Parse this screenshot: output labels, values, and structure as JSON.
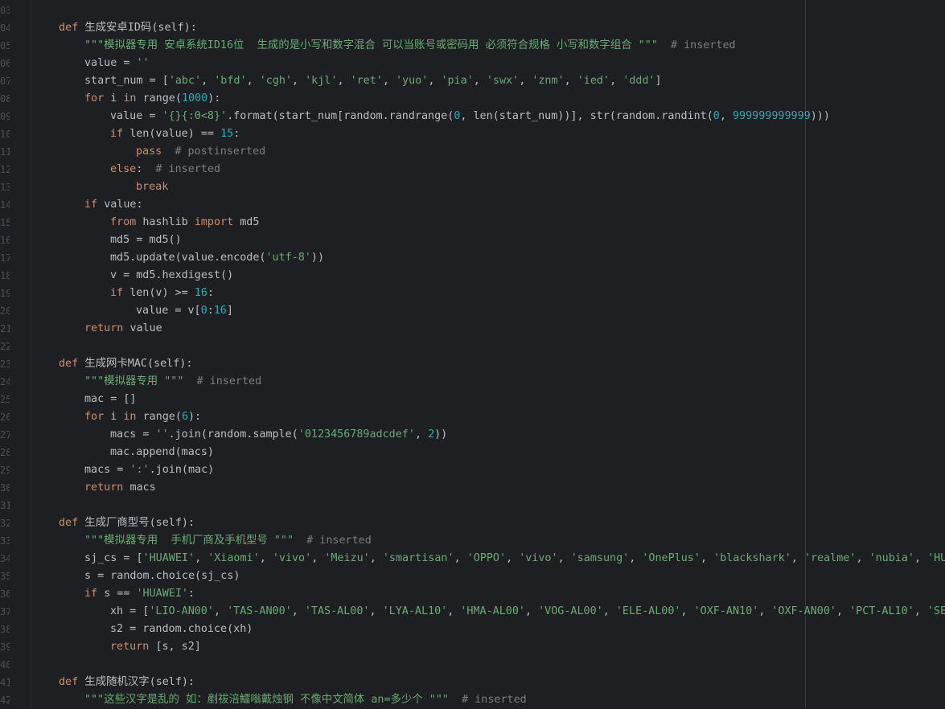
{
  "lines": [
    {
      "n": "03",
      "indent": 0,
      "tokens": []
    },
    {
      "n": "04",
      "indent": 0,
      "tokens": [
        [
          "kw",
          "def "
        ],
        [
          "fn",
          "生成安卓ID码(self):"
        ]
      ]
    },
    {
      "n": "05",
      "indent": 1,
      "tokens": [
        [
          "str",
          "\"\"\"模拟器专用 安卓系统ID16位  生成的是小写和数字混合 可以当账号或密码用 必须符合规格 小写和数字组合 \"\"\""
        ],
        [
          "com",
          "  # inserted"
        ]
      ]
    },
    {
      "n": "06",
      "indent": 1,
      "tokens": [
        [
          "fn",
          "value = "
        ],
        [
          "str",
          "''"
        ]
      ]
    },
    {
      "n": "07",
      "indent": 1,
      "tokens": [
        [
          "fn",
          "start_num = ["
        ],
        [
          "str",
          "'abc'"
        ],
        [
          "fn",
          ", "
        ],
        [
          "str",
          "'bfd'"
        ],
        [
          "fn",
          ", "
        ],
        [
          "str",
          "'cgh'"
        ],
        [
          "fn",
          ", "
        ],
        [
          "str",
          "'kjl'"
        ],
        [
          "fn",
          ", "
        ],
        [
          "str",
          "'ret'"
        ],
        [
          "fn",
          ", "
        ],
        [
          "str",
          "'yuo'"
        ],
        [
          "fn",
          ", "
        ],
        [
          "str",
          "'pia'"
        ],
        [
          "fn",
          ", "
        ],
        [
          "str",
          "'swx'"
        ],
        [
          "fn",
          ", "
        ],
        [
          "str",
          "'znm'"
        ],
        [
          "fn",
          ", "
        ],
        [
          "str",
          "'ied'"
        ],
        [
          "fn",
          ", "
        ],
        [
          "str",
          "'ddd'"
        ],
        [
          "fn",
          "]"
        ]
      ]
    },
    {
      "n": "08",
      "indent": 1,
      "tokens": [
        [
          "kw",
          "for "
        ],
        [
          "fn",
          "i "
        ],
        [
          "kw",
          "in "
        ],
        [
          "fn",
          "range("
        ],
        [
          "num",
          "1000"
        ],
        [
          "fn",
          "):"
        ]
      ]
    },
    {
      "n": "09",
      "indent": 2,
      "tokens": [
        [
          "fn",
          "value = "
        ],
        [
          "str",
          "'{}{:0<8}'"
        ],
        [
          "fn",
          ".format(start_num[random.randrange("
        ],
        [
          "num",
          "0"
        ],
        [
          "fn",
          ", len(start_num))], str(random.randint("
        ],
        [
          "num",
          "0"
        ],
        [
          "fn",
          ", "
        ],
        [
          "num",
          "999999999999"
        ],
        [
          "fn",
          ")))"
        ]
      ]
    },
    {
      "n": "10",
      "indent": 2,
      "tokens": [
        [
          "kw",
          "if "
        ],
        [
          "fn",
          "len(value) == "
        ],
        [
          "num",
          "15"
        ],
        [
          "fn",
          ":"
        ]
      ]
    },
    {
      "n": "11",
      "indent": 3,
      "tokens": [
        [
          "kw",
          "pass"
        ],
        [
          "com",
          "  # postinserted"
        ]
      ]
    },
    {
      "n": "12",
      "indent": 2,
      "tokens": [
        [
          "kw",
          "else"
        ],
        [
          "fn",
          ":"
        ],
        [
          "com",
          "  # inserted"
        ]
      ]
    },
    {
      "n": "13",
      "indent": 3,
      "tokens": [
        [
          "kw",
          "break"
        ]
      ]
    },
    {
      "n": "14",
      "indent": 1,
      "tokens": [
        [
          "kw",
          "if "
        ],
        [
          "fn",
          "value:"
        ]
      ]
    },
    {
      "n": "15",
      "indent": 2,
      "tokens": [
        [
          "kw",
          "from "
        ],
        [
          "fn",
          "hashlib "
        ],
        [
          "kw",
          "import "
        ],
        [
          "fn",
          "md5"
        ]
      ]
    },
    {
      "n": "16",
      "indent": 2,
      "tokens": [
        [
          "fn",
          "md5 = md5()"
        ]
      ]
    },
    {
      "n": "17",
      "indent": 2,
      "tokens": [
        [
          "fn",
          "md5.update(value.encode("
        ],
        [
          "str",
          "'utf-8'"
        ],
        [
          "fn",
          "))"
        ]
      ]
    },
    {
      "n": "18",
      "indent": 2,
      "tokens": [
        [
          "fn",
          "v = md5.hexdigest()"
        ]
      ]
    },
    {
      "n": "19",
      "indent": 2,
      "tokens": [
        [
          "kw",
          "if "
        ],
        [
          "fn",
          "len(v) >= "
        ],
        [
          "num",
          "16"
        ],
        [
          "fn",
          ":"
        ]
      ]
    },
    {
      "n": "20",
      "indent": 3,
      "tokens": [
        [
          "fn",
          "value = v["
        ],
        [
          "num",
          "0"
        ],
        [
          "fn",
          ":"
        ],
        [
          "num",
          "16"
        ],
        [
          "fn",
          "]"
        ]
      ]
    },
    {
      "n": "21",
      "indent": 1,
      "tokens": [
        [
          "kw",
          "return "
        ],
        [
          "fn",
          "value"
        ]
      ]
    },
    {
      "n": "22",
      "indent": 0,
      "tokens": []
    },
    {
      "n": "23",
      "indent": 0,
      "tokens": [
        [
          "kw",
          "def "
        ],
        [
          "fn",
          "生成网卡MAC(self):"
        ]
      ]
    },
    {
      "n": "24",
      "indent": 1,
      "tokens": [
        [
          "str",
          "\"\"\"模拟器专用 \"\"\""
        ],
        [
          "com",
          "  # inserted"
        ]
      ]
    },
    {
      "n": "25",
      "indent": 1,
      "tokens": [
        [
          "fn",
          "mac = []"
        ]
      ]
    },
    {
      "n": "26",
      "indent": 1,
      "tokens": [
        [
          "kw",
          "for "
        ],
        [
          "fn",
          "i "
        ],
        [
          "kw",
          "in "
        ],
        [
          "fn",
          "range("
        ],
        [
          "num",
          "6"
        ],
        [
          "fn",
          "):"
        ]
      ]
    },
    {
      "n": "27",
      "indent": 2,
      "tokens": [
        [
          "fn",
          "macs = "
        ],
        [
          "str",
          "''"
        ],
        [
          "fn",
          ".join(random.sample("
        ],
        [
          "str",
          "'0123456789adcdef'"
        ],
        [
          "fn",
          ", "
        ],
        [
          "num",
          "2"
        ],
        [
          "fn",
          "))"
        ]
      ]
    },
    {
      "n": "28",
      "indent": 2,
      "tokens": [
        [
          "fn",
          "mac.append(macs)"
        ]
      ]
    },
    {
      "n": "29",
      "indent": 1,
      "tokens": [
        [
          "fn",
          "macs = "
        ],
        [
          "str",
          "':'"
        ],
        [
          "fn",
          ".join(mac)"
        ]
      ]
    },
    {
      "n": "30",
      "indent": 1,
      "tokens": [
        [
          "kw",
          "return "
        ],
        [
          "fn",
          "macs"
        ]
      ]
    },
    {
      "n": "31",
      "indent": 0,
      "tokens": []
    },
    {
      "n": "32",
      "indent": 0,
      "tokens": [
        [
          "kw",
          "def "
        ],
        [
          "fn",
          "生成厂商型号(self):"
        ]
      ]
    },
    {
      "n": "33",
      "indent": 1,
      "tokens": [
        [
          "str",
          "\"\"\"模拟器专用  手机厂商及手机型号 \"\"\""
        ],
        [
          "com",
          "  # inserted"
        ]
      ]
    },
    {
      "n": "34",
      "indent": 1,
      "tokens": [
        [
          "fn",
          "sj_cs = ["
        ],
        [
          "str",
          "'HUAWEI'"
        ],
        [
          "fn",
          ", "
        ],
        [
          "str",
          "'Xiaomi'"
        ],
        [
          "fn",
          ", "
        ],
        [
          "str",
          "'vivo'"
        ],
        [
          "fn",
          ", "
        ],
        [
          "str",
          "'Meizu'"
        ],
        [
          "fn",
          ", "
        ],
        [
          "str",
          "'smartisan'"
        ],
        [
          "fn",
          ", "
        ],
        [
          "str",
          "'OPPO'"
        ],
        [
          "fn",
          ", "
        ],
        [
          "str",
          "'vivo'"
        ],
        [
          "fn",
          ", "
        ],
        [
          "str",
          "'samsung'"
        ],
        [
          "fn",
          ", "
        ],
        [
          "str",
          "'OnePlus'"
        ],
        [
          "fn",
          ", "
        ],
        [
          "str",
          "'blackshark'"
        ],
        [
          "fn",
          ", "
        ],
        [
          "str",
          "'realme'"
        ],
        [
          "fn",
          ", "
        ],
        [
          "str",
          "'nubia'"
        ],
        [
          "fn",
          ", "
        ],
        [
          "str",
          "'HUA"
        ]
      ]
    },
    {
      "n": "35",
      "indent": 1,
      "tokens": [
        [
          "fn",
          "s = random.choice(sj_cs)"
        ]
      ]
    },
    {
      "n": "36",
      "indent": 1,
      "tokens": [
        [
          "kw",
          "if "
        ],
        [
          "fn",
          "s == "
        ],
        [
          "str",
          "'HUAWEI'"
        ],
        [
          "fn",
          ":"
        ]
      ]
    },
    {
      "n": "37",
      "indent": 2,
      "tokens": [
        [
          "fn",
          "xh = ["
        ],
        [
          "str",
          "'LIO-AN00'"
        ],
        [
          "fn",
          ", "
        ],
        [
          "str",
          "'TAS-AN00'"
        ],
        [
          "fn",
          ", "
        ],
        [
          "str",
          "'TAS-AL00'"
        ],
        [
          "fn",
          ", "
        ],
        [
          "str",
          "'LYA-AL10'"
        ],
        [
          "fn",
          ", "
        ],
        [
          "str",
          "'HMA-AL00'"
        ],
        [
          "fn",
          ", "
        ],
        [
          "str",
          "'VOG-AL00'"
        ],
        [
          "fn",
          ", "
        ],
        [
          "str",
          "'ELE-AL00'"
        ],
        [
          "fn",
          ", "
        ],
        [
          "str",
          "'OXF-AN10'"
        ],
        [
          "fn",
          ", "
        ],
        [
          "str",
          "'OXF-AN00'"
        ],
        [
          "fn",
          ", "
        ],
        [
          "str",
          "'PCT-AL10'"
        ],
        [
          "fn",
          ", "
        ],
        [
          "str",
          "'SEA"
        ]
      ]
    },
    {
      "n": "38",
      "indent": 2,
      "tokens": [
        [
          "fn",
          "s2 = random.choice(xh)"
        ]
      ]
    },
    {
      "n": "39",
      "indent": 2,
      "tokens": [
        [
          "kw",
          "return "
        ],
        [
          "fn",
          "[s, s2]"
        ]
      ]
    },
    {
      "n": "40",
      "indent": 0,
      "tokens": []
    },
    {
      "n": "41",
      "indent": 0,
      "tokens": [
        [
          "kw",
          "def "
        ],
        [
          "fn",
          "生成随机汉字(self):"
        ]
      ]
    },
    {
      "n": "42",
      "indent": 1,
      "tokens": [
        [
          "str",
          "\"\"\"这些汉字是乱的 如：剷祓涪鱩嗡戴烛钢 不像中文简体 an=多少个 \"\"\""
        ],
        [
          "com",
          "  # inserted"
        ]
      ]
    }
  ]
}
